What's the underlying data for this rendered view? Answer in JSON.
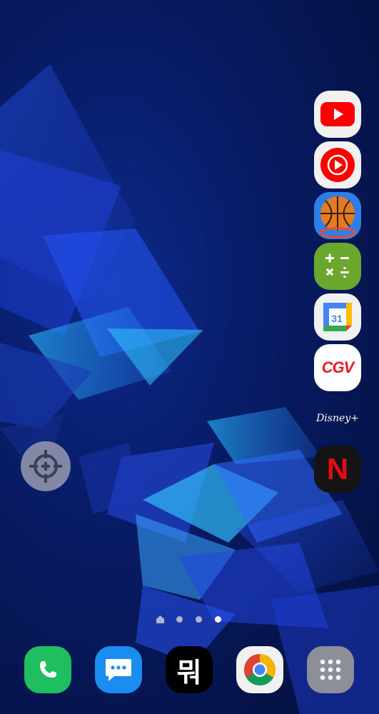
{
  "screen": {
    "type": "android-home-screen"
  },
  "right_apps": [
    {
      "name": "YouTube",
      "icon": "youtube-icon"
    },
    {
      "name": "YouTube Music",
      "icon": "youtube-music-icon"
    },
    {
      "name": "Basketball game",
      "icon": "basketball-icon"
    },
    {
      "name": "Calculator",
      "icon": "calculator-icon"
    },
    {
      "name": "Google Calendar",
      "icon": "calendar-icon",
      "text": "31"
    },
    {
      "name": "CGV",
      "icon": "cgv-icon",
      "text": "CGV"
    },
    {
      "name": "Disney+",
      "icon": "disney-plus-icon",
      "text": "Disney+"
    },
    {
      "name": "Netflix",
      "icon": "netflix-icon",
      "text": "N"
    }
  ],
  "floating_button": {
    "icon": "crosshair-icon"
  },
  "page_indicator": {
    "pages": 4,
    "current": 4,
    "home_page": 1
  },
  "dock": [
    {
      "name": "Phone",
      "icon": "phone-icon"
    },
    {
      "name": "Messages",
      "icon": "messages-icon"
    },
    {
      "name": "App",
      "icon": "hangul-app-icon",
      "text": "뭐"
    },
    {
      "name": "Chrome",
      "icon": "chrome-icon"
    },
    {
      "name": "Apps",
      "icon": "app-drawer-icon"
    }
  ],
  "colors": {
    "youtube_red": "#ff0000",
    "calc_green": "#6aa72c",
    "phone_green": "#1fbe5f",
    "messages_blue": "#1b8cf0",
    "netflix_red": "#e50914"
  }
}
